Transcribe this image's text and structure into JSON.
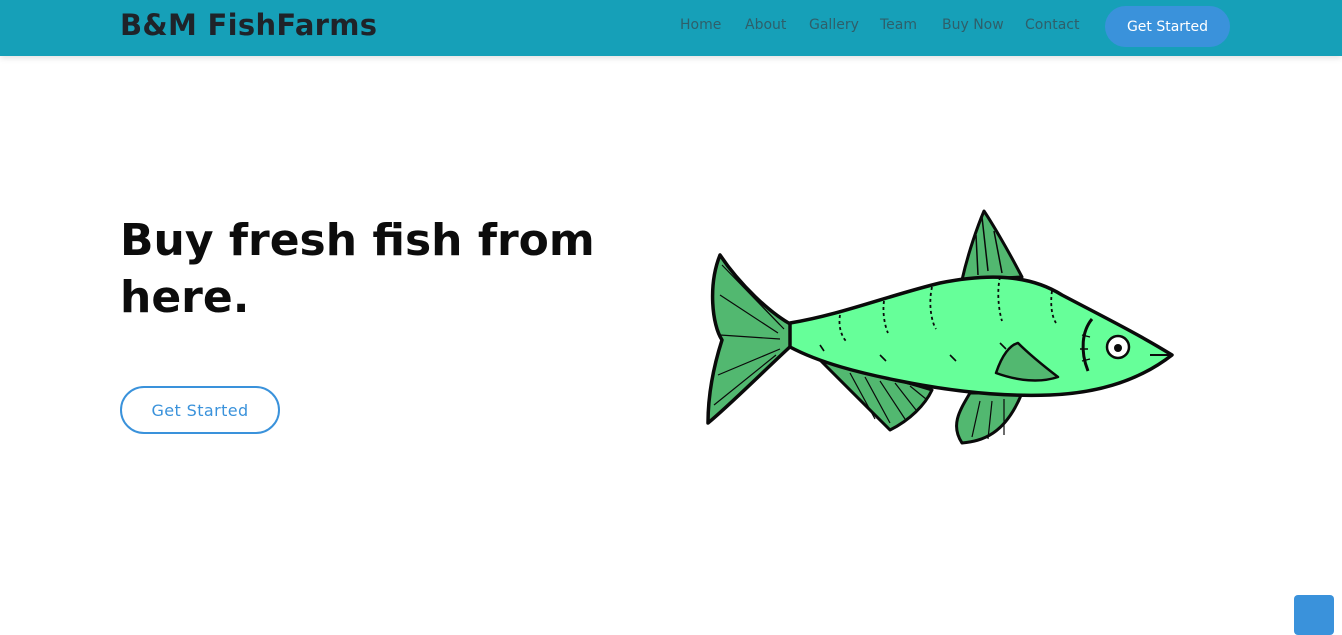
{
  "brand": {
    "name": "B&M FishFarms"
  },
  "nav": {
    "items": [
      {
        "label": "Home"
      },
      {
        "label": "About"
      },
      {
        "label": "Gallery"
      },
      {
        "label": "Team"
      },
      {
        "label": "Buy Now"
      },
      {
        "label": "Contact"
      }
    ],
    "cta_label": "Get Started"
  },
  "hero": {
    "headline": "Buy fresh fish from here.",
    "cta_label": "Get Started",
    "image_icon": "green-fish-illustration"
  },
  "colors": {
    "navbar": "#16a0b8",
    "accent": "#3a92db",
    "fish_body": "#66ff99",
    "fish_fins": "#52b870",
    "text_dark": "#0c0c0c"
  }
}
